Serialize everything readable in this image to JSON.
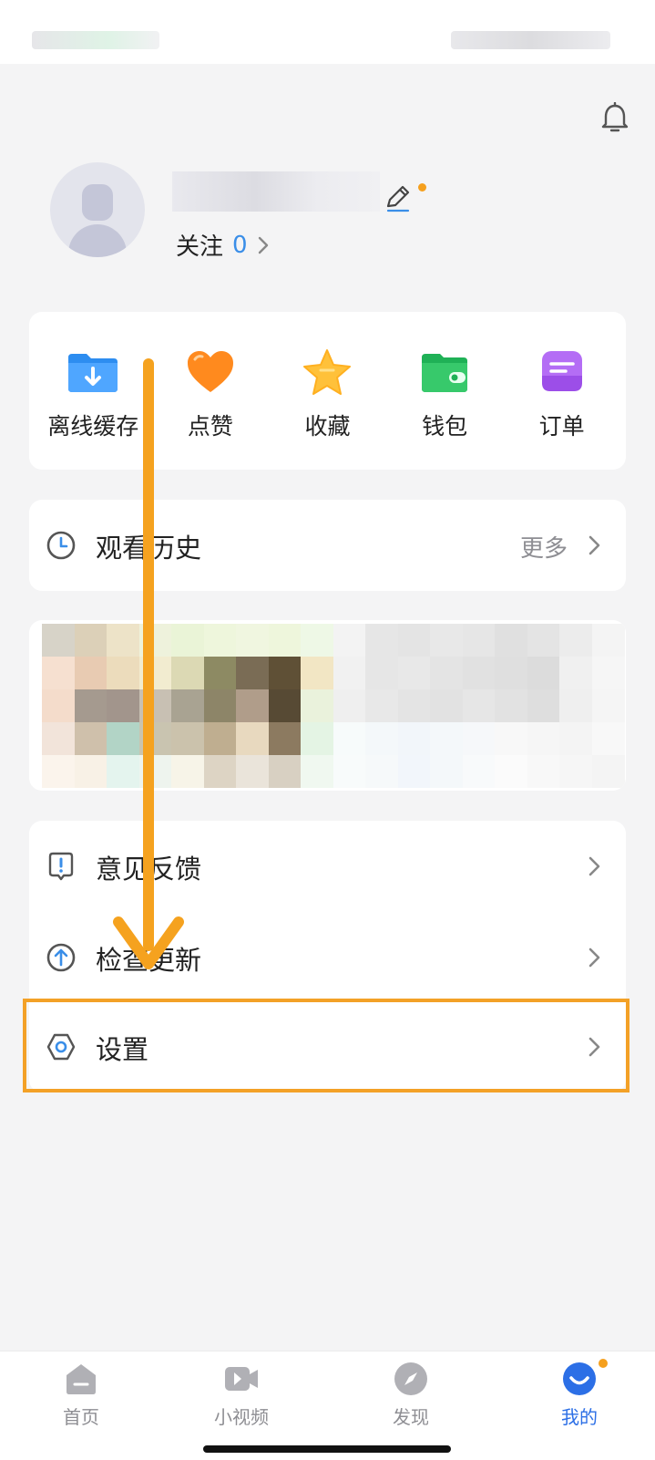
{
  "header": {
    "follow_label": "关注",
    "follow_count": "0"
  },
  "quick_actions": [
    {
      "label": "离线缓存",
      "icon": "download-folder-icon"
    },
    {
      "label": "点赞",
      "icon": "heart-icon"
    },
    {
      "label": "收藏",
      "icon": "star-icon"
    },
    {
      "label": "钱包",
      "icon": "wallet-icon"
    },
    {
      "label": "订单",
      "icon": "order-icon"
    }
  ],
  "history": {
    "label": "观看历史",
    "more": "更多"
  },
  "menu": [
    {
      "label": "意见反馈",
      "icon": "feedback-icon"
    },
    {
      "label": "检查更新",
      "icon": "update-icon"
    },
    {
      "label": "设置",
      "icon": "settings-icon"
    }
  ],
  "tabbar": [
    {
      "label": "首页",
      "icon": "home-icon"
    },
    {
      "label": "小视频",
      "icon": "video-icon"
    },
    {
      "label": "发现",
      "icon": "compass-icon"
    },
    {
      "label": "我的",
      "icon": "me-icon"
    }
  ],
  "colors": {
    "accent": "#3a8ee8",
    "annotation": "#f3a127",
    "badge": "#f5a01e",
    "active_tab": "#2c6fe6"
  }
}
